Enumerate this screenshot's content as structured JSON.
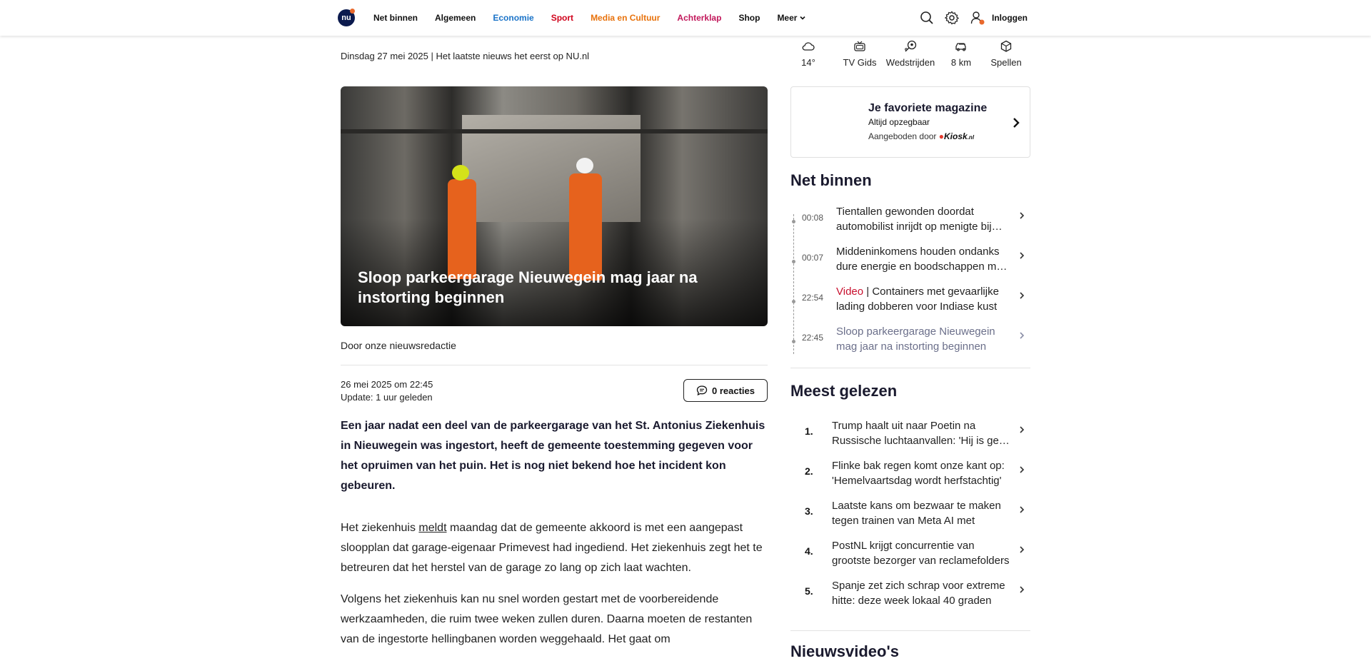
{
  "header": {
    "logo_text": "nu",
    "nav": [
      {
        "label": "Net binnen",
        "color": "#111111"
      },
      {
        "label": "Algemeen",
        "color": "#111111"
      },
      {
        "label": "Economie",
        "color": "#1a73c8"
      },
      {
        "label": "Sport",
        "color": "#d0021b"
      },
      {
        "label": "Media en Cultuur",
        "color": "#e8720c"
      },
      {
        "label": "Achterklap",
        "color": "#c2185b"
      },
      {
        "label": "Shop",
        "color": "#111111"
      },
      {
        "label": "Meer",
        "color": "#111111"
      }
    ],
    "login_label": "Inloggen",
    "icons": [
      "search-icon",
      "settings-icon",
      "user-icon"
    ]
  },
  "dateline": "Dinsdag 27 mei 2025 | Het laatste nieuws het eerst op NU.nl",
  "article": {
    "hero_title": "Sloop parkeergarage Nieuwegein mag jaar na instorting beginnen",
    "byline": "Door onze nieuwsredactie",
    "published": "26 mei 2025 om 22:45",
    "updated": "Update: 1 uur geleden",
    "reactions_label": "0 reacties",
    "lead": "Een jaar nadat een deel van de parkeergarage van het St. Antonius Ziekenhuis in Nieuwegein was ingestort, heeft de gemeente toestemming gegeven voor het opruimen van het puin. Het is nog niet bekend hoe het incident kon gebeuren.",
    "p1_before": "Het ziekenhuis ",
    "p1_link": "meldt",
    "p1_after": " maandag dat de gemeente akkoord is met een aangepast sloopplan dat garage-eigenaar Primevest had ingediend. Het ziekenhuis zegt het te betreuren dat het herstel van de garage zo lang op zich laat wachten.",
    "p2": "Volgens het ziekenhuis kan nu snel worden gestart met de voorbereidende werkzaamheden, die ruim twee weken zullen duren. Daarna moeten de restanten van de ingestorte hellingbanen worden weggehaald. Het gaat om"
  },
  "quicklinks": [
    {
      "label": "14°",
      "icon": "cloud-icon"
    },
    {
      "label": "TV Gids",
      "icon": "tv-icon"
    },
    {
      "label": "Wedstrijden",
      "icon": "football-icon"
    },
    {
      "label": "8 km",
      "icon": "traffic-icon"
    },
    {
      "label": "Spellen",
      "icon": "cube-icon"
    }
  ],
  "kiosk": {
    "title": "Je favoriete magazine",
    "subtitle": "Altijd opzegbaar",
    "offered_by": "Aangeboden door",
    "brand": "Kiosk",
    "brand_suffix": ".nl"
  },
  "net_binnen": {
    "title": "Net binnen",
    "items": [
      {
        "time": "00:08",
        "tag": "",
        "text": "Tientallen gewonden doordat automobilist inrijdt op menigte bij…"
      },
      {
        "time": "00:07",
        "tag": "",
        "text": "Middeninkomens houden ondanks dure energie en boodschappen m…"
      },
      {
        "time": "22:54",
        "tag": "Video",
        "text": "Containers met gevaarlijke lading dobberen voor Indiase kust"
      },
      {
        "time": "22:45",
        "tag": "",
        "text": "Sloop parkeergarage Nieuwegein mag jaar na instorting beginnen"
      }
    ]
  },
  "meest_gelezen": {
    "title": "Meest gelezen",
    "items": [
      {
        "num": "1.",
        "text": "Trump haalt uit naar Poetin na Russische luchtaanvallen: 'Hij is ge…"
      },
      {
        "num": "2.",
        "text": "Flinke bak regen komt onze kant op: 'Hemelvaartsdag wordt herfstachtig'"
      },
      {
        "num": "3.",
        "text": "Laatste kans om bezwaar te maken tegen trainen van Meta AI met jouw…"
      },
      {
        "num": "4.",
        "text": "PostNL krijgt concurrentie van grootste bezorger van reclamefolders"
      },
      {
        "num": "5.",
        "text": "Spanje zet zich schrap voor extreme hitte: deze week lokaal 40 graden"
      }
    ]
  },
  "next_section_title": "Nieuwsvideo's"
}
